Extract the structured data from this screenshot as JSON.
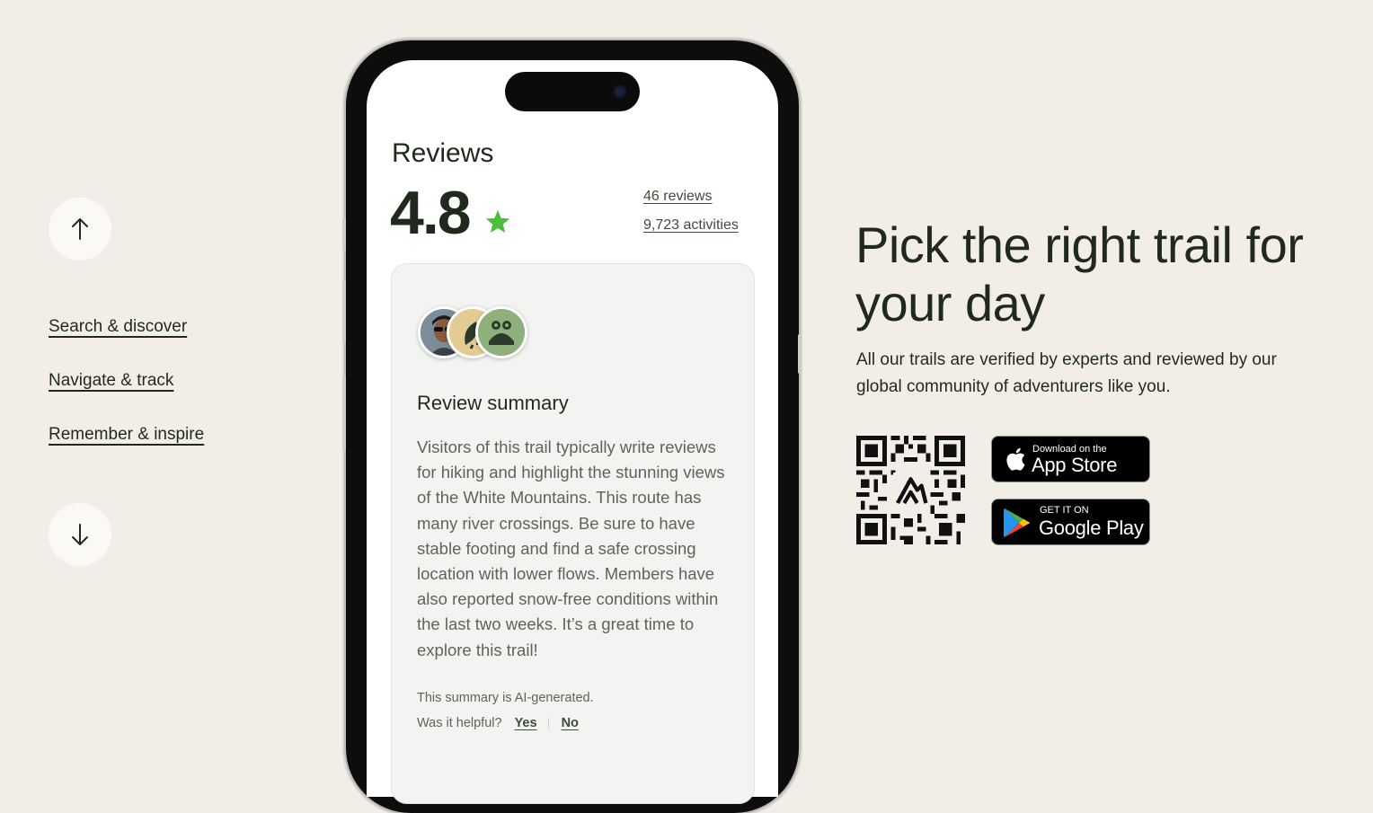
{
  "nav": {
    "up_icon": "arrow-up-icon",
    "down_icon": "arrow-down-icon",
    "items": [
      {
        "label": "Search & discover"
      },
      {
        "label": "Navigate & track"
      },
      {
        "label": "Remember & inspire"
      }
    ]
  },
  "phone": {
    "reviews_title": "Reviews",
    "rating": "4.8",
    "rating_icon": "star-icon",
    "rating_icon_color": "#4bbf3a",
    "reviews_count": "46 reviews",
    "activities_count": "9,723 activities",
    "summary": {
      "avatars": [
        "user-photo-avatar",
        "plant-avatar",
        "frog-avatar"
      ],
      "heading": "Review summary",
      "body": "Visitors of this trail typically write reviews for hiking and highlight the stunning views of the White Mountains. This route has many river crossings. Be sure to have stable footing and find a safe crossing location with lower flows. Members have also reported snow-free conditions within the last two weeks. It’s a great time to explore this trail!",
      "ai_note": "This summary is AI-generated.",
      "helpful_prompt": "Was it helpful?",
      "yes_label": "Yes",
      "no_label": "No"
    }
  },
  "promo": {
    "headline": "Pick the right trail for your day",
    "subtext": "All our trails are verified by experts and reviewed by our global community of adventurers like you.",
    "qr_icon": "qr-code-icon",
    "app_store": {
      "small": "Download on the",
      "big": "App Store",
      "icon": "apple-icon"
    },
    "google_play": {
      "small": "GET IT ON",
      "big": "Google Play",
      "icon": "google-play-icon"
    }
  },
  "colors": {
    "background": "#f2ede6",
    "text": "#1f2a1d",
    "accent_star": "#4bbf3a"
  }
}
